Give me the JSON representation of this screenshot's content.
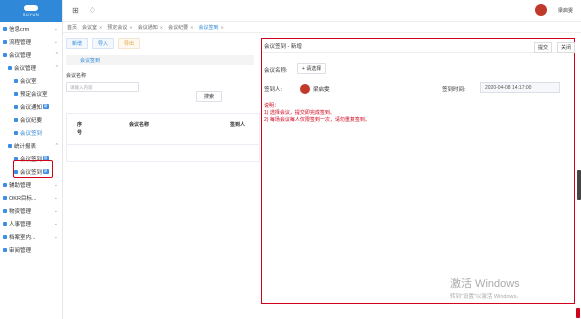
{
  "sidebar": {
    "logo_text": "SUYUN",
    "items": [
      {
        "label": "信息crm",
        "level": 0
      },
      {
        "label": "流程管理",
        "level": 0
      },
      {
        "label": "会议管理",
        "level": 0
      },
      {
        "label": "会议管理",
        "level": 1
      },
      {
        "label": "会议室",
        "level": 2
      },
      {
        "label": "预定会议室",
        "level": 2
      },
      {
        "label": "会议通知",
        "level": 2,
        "badge": "新"
      },
      {
        "label": "会议纪要",
        "level": 2
      },
      {
        "label": "会议签到",
        "level": 2,
        "active": true
      },
      {
        "label": "统计报表",
        "level": 1
      },
      {
        "label": "会议签到",
        "level": 2,
        "badge": "新"
      },
      {
        "label": "会议签到",
        "level": 2,
        "badge": "新"
      },
      {
        "label": "辅助管理",
        "level": 0
      },
      {
        "label": "OKR目标...",
        "level": 0
      },
      {
        "label": "物资管理",
        "level": 0
      },
      {
        "label": "人事管理",
        "level": 0
      },
      {
        "label": "档案室内...",
        "level": 0
      },
      {
        "label": "审阅管理",
        "level": 0
      }
    ]
  },
  "header": {
    "user_name": "梁启雯"
  },
  "tabs": [
    {
      "label": "首页",
      "active": false
    },
    {
      "label": "会议室",
      "active": false
    },
    {
      "label": "预定会议",
      "active": false
    },
    {
      "label": "会议通知",
      "active": false
    },
    {
      "label": "会议纪要",
      "active": false
    },
    {
      "label": "会议签到",
      "active": true
    }
  ],
  "left": {
    "toolbar": {
      "add_label": "新增",
      "import_label": "导入",
      "export_label": "导出"
    },
    "subtab_label": "会议签到",
    "search_label": "会议名称",
    "search_placeholder": "请输入内容",
    "search_button": "搜索",
    "table_headers": [
      "序号",
      "会议名称",
      "签到人"
    ]
  },
  "right": {
    "title": "会议签到 - 新增",
    "submit_label": "提交",
    "close_label": "关闭",
    "meeting_name_label": "会议名称:",
    "select_label": "+ 请选择",
    "signer_label": "签到人:",
    "signer_name": "梁启雯",
    "time_label": "签到时间:",
    "time_value": "2020-04-08 14:17:00",
    "note_title": "说明：",
    "note_line1": "1) 选择会议，提交即完成签到。",
    "note_line2": "2) 每场会议每人仅限签到一次，请勿重复签到。"
  },
  "watermark": {
    "line1": "激活 Windows",
    "line2": "转到\"设置\"以激活 Windows。"
  },
  "colors": {
    "primary": "#2f88d8",
    "highlight": "#d0021b"
  }
}
